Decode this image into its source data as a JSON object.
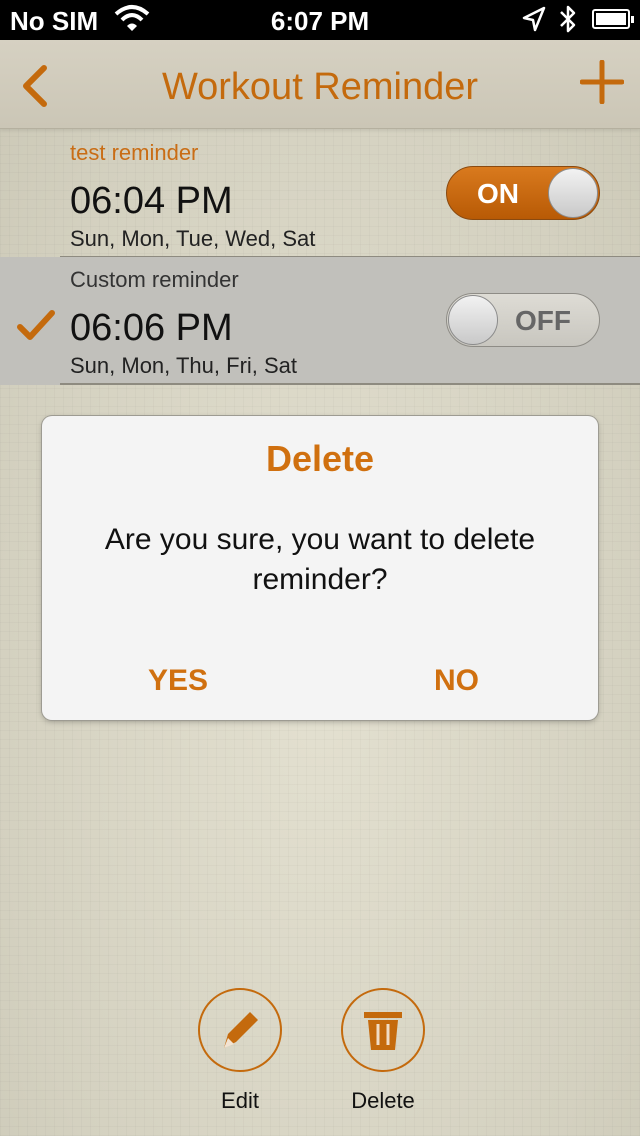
{
  "status_bar": {
    "carrier": "No SIM",
    "time": "6:07 PM",
    "wifi_icon": "wifi-icon",
    "location_icon": "location-arrow-icon",
    "bluetooth_icon": "bluetooth-icon",
    "battery_icon": "battery-icon"
  },
  "navbar": {
    "title": "Workout Reminder",
    "back_icon": "chevron-left-icon",
    "add_icon": "plus-icon"
  },
  "reminders": [
    {
      "name": "test reminder",
      "time": "06:04 PM",
      "days": "Sun, Mon, Tue, Wed, Sat",
      "toggle": "ON",
      "enabled": true,
      "selected": false
    },
    {
      "name": "Custom reminder",
      "time": "06:06 PM",
      "days": "Sun, Mon, Thu, Fri, Sat",
      "toggle": "OFF",
      "enabled": false,
      "selected": true
    }
  ],
  "dialog": {
    "title": "Delete",
    "message": "Are you sure, you want to delete reminder?",
    "yes": "YES",
    "no": "NO"
  },
  "actions": {
    "edit": {
      "label": "Edit",
      "icon": "pencil-icon"
    },
    "delete": {
      "label": "Delete",
      "icon": "trash-icon"
    }
  },
  "colors": {
    "accent": "#c46a0d",
    "toggle_on": "#c8660f",
    "selected_row": "#c1c0bb"
  }
}
